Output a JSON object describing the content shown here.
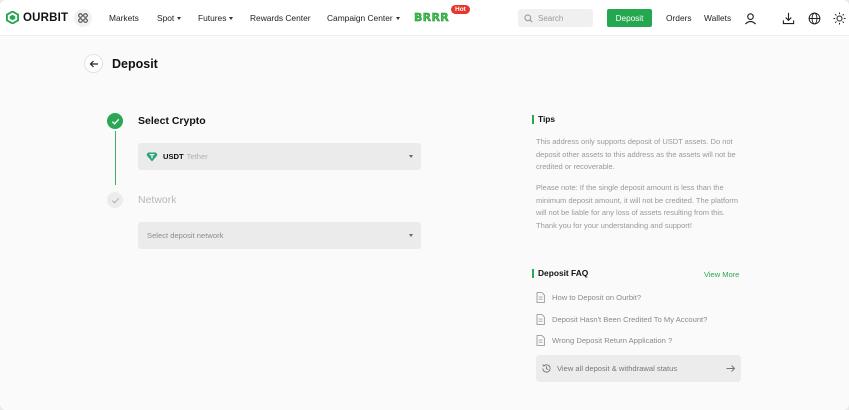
{
  "brand": {
    "name": "OURBIT",
    "accent": "#25a750"
  },
  "nav": {
    "items": [
      {
        "label": "Markets",
        "dropdown": false
      },
      {
        "label": "Spot",
        "dropdown": true
      },
      {
        "label": "Futures",
        "dropdown": true
      },
      {
        "label": "Rewards Center",
        "dropdown": false
      },
      {
        "label": "Campaign Center",
        "dropdown": true
      }
    ],
    "promo_label": "BRRR",
    "promo_badge": "Hot",
    "search_placeholder": "Search",
    "deposit_button": "Deposit",
    "orders_label": "Orders",
    "wallets_label": "Wallets",
    "icons": [
      "apps-icon",
      "user-icon",
      "download-icon",
      "globe-icon",
      "theme-sun-icon"
    ]
  },
  "page": {
    "title": "Deposit",
    "steps": {
      "select_crypto": "Select Crypto",
      "network": "Network"
    },
    "crypto_select": {
      "symbol": "USDT",
      "name": "Tether",
      "icon": "tether-gem-icon"
    },
    "network_select": {
      "placeholder": "Select deposit network"
    }
  },
  "tips": {
    "title": "Tips",
    "paragraph1": "This address only supports deposit of USDT assets. Do not deposit other assets to this address as the assets will not be credited or recoverable.",
    "paragraph2": "Please note: If the single deposit amount is less than the minimum deposit amount, it will not be credited. The platform will not be liable for any loss of assets resulting from this. Thank you for your understanding and support!"
  },
  "faq": {
    "title": "Deposit FAQ",
    "view_more": "View More",
    "items": [
      "How to Deposit on Ourbit?",
      "Deposit Hasn't Been Credited To My Account?",
      "Wrong Deposit Return Application ?"
    ],
    "status_link": "View all deposit & withdrawal status"
  }
}
